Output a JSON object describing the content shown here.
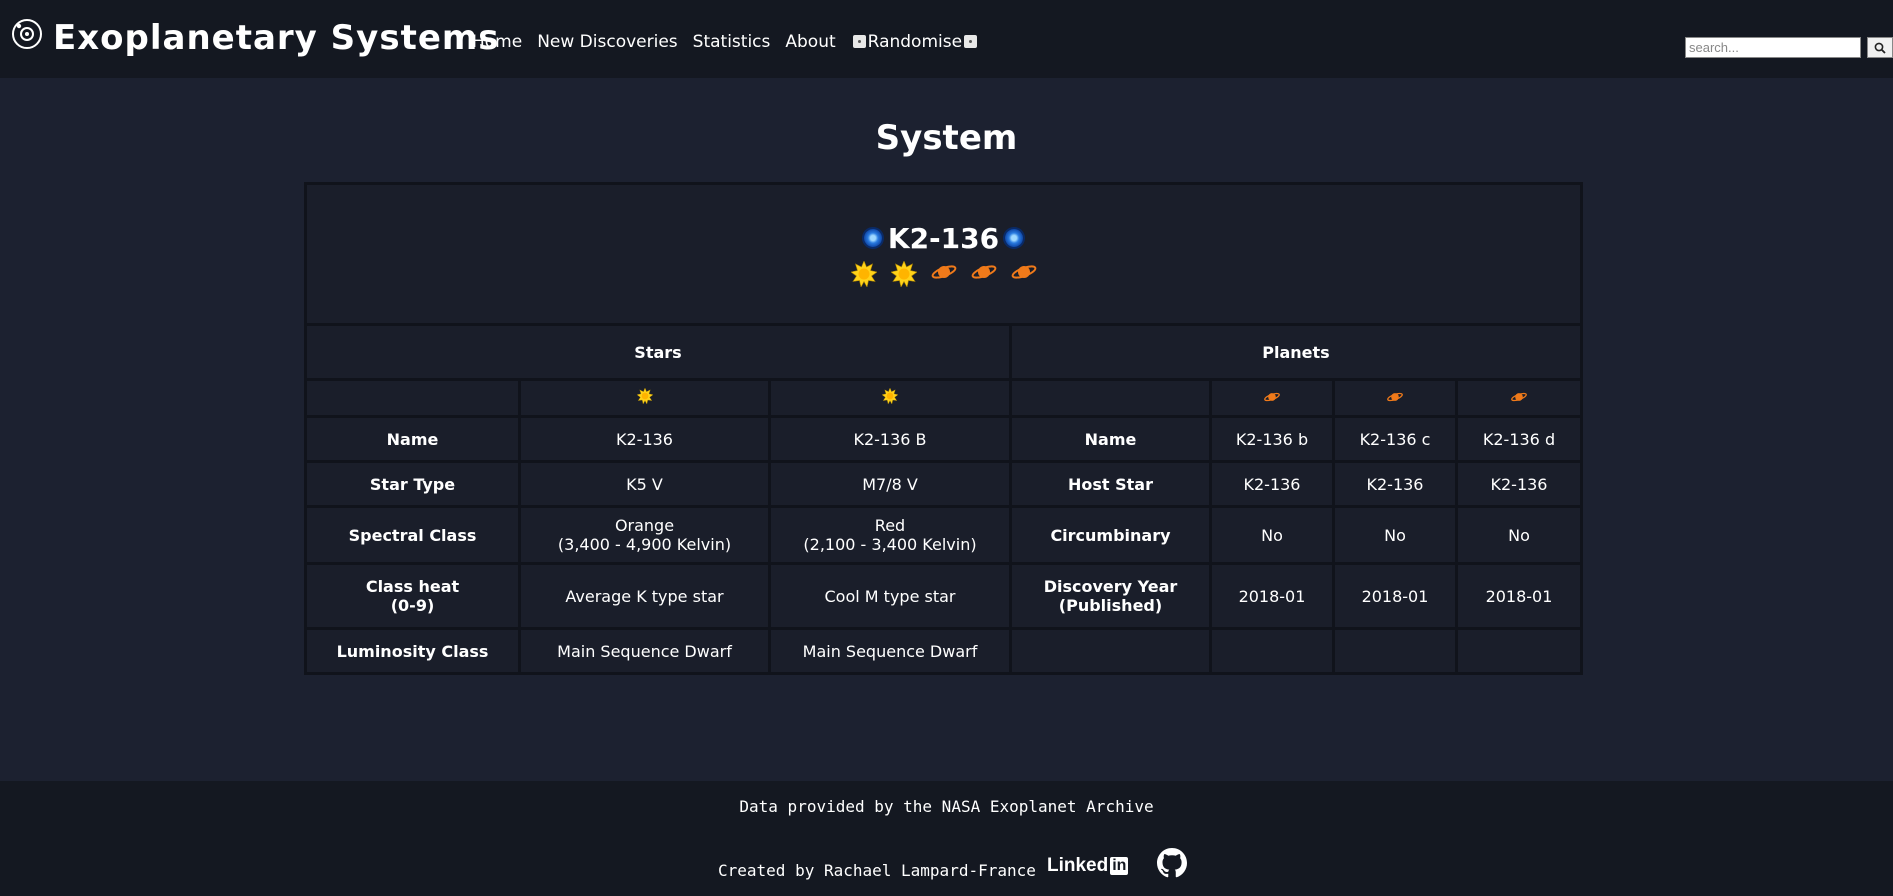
{
  "nav": {
    "brand": "Exoplanetary Systems",
    "links": [
      "Home",
      "New Discoveries",
      "Statistics",
      "About"
    ],
    "randomise_label": "Randomise",
    "search_placeholder": "search..."
  },
  "page_title": "System",
  "system": {
    "name": "K2-136",
    "stars_header": "Stars",
    "planets_header": "Planets",
    "star_labels": [
      "Name",
      "Star Type",
      "Spectral Class",
      "Class heat",
      "Luminosity Class"
    ],
    "class_heat_sub": "(0-9)",
    "stars": [
      {
        "name": "K2-136",
        "type": "K5 V",
        "spectral_color": "Orange",
        "spectral_range": "(3,400 - 4,900 Kelvin)",
        "class_heat": "Average K type star",
        "luminosity": "Main Sequence Dwarf"
      },
      {
        "name": "K2-136 B",
        "type": "M7/8 V",
        "spectral_color": "Red",
        "spectral_range": "(2,100 - 3,400 Kelvin)",
        "class_heat": "Cool M type star",
        "luminosity": "Main Sequence Dwarf"
      }
    ],
    "planet_labels": [
      "Name",
      "Host Star",
      "Circumbinary",
      "Discovery Year"
    ],
    "discovery_sub": "(Published)",
    "planets": [
      {
        "name": "K2-136 b",
        "host": "K2-136",
        "circumbinary": "No",
        "discovery": "2018-01"
      },
      {
        "name": "K2-136 c",
        "host": "K2-136",
        "circumbinary": "No",
        "discovery": "2018-01"
      },
      {
        "name": "K2-136 d",
        "host": "K2-136",
        "circumbinary": "No",
        "discovery": "2018-01"
      }
    ]
  },
  "footer": {
    "credit": "Data provided by the NASA Exoplanet Archive",
    "creator": "Created by Rachael Lampard-France",
    "linkedin_text": "Linked",
    "linkedin_box": "in"
  },
  "colors": {
    "background": "#1c2130",
    "navbar": "#141821",
    "table_border": "#10131b",
    "cell": "#1a1e2a",
    "sun": "#ffd21a",
    "planet": "#f07a1a"
  }
}
